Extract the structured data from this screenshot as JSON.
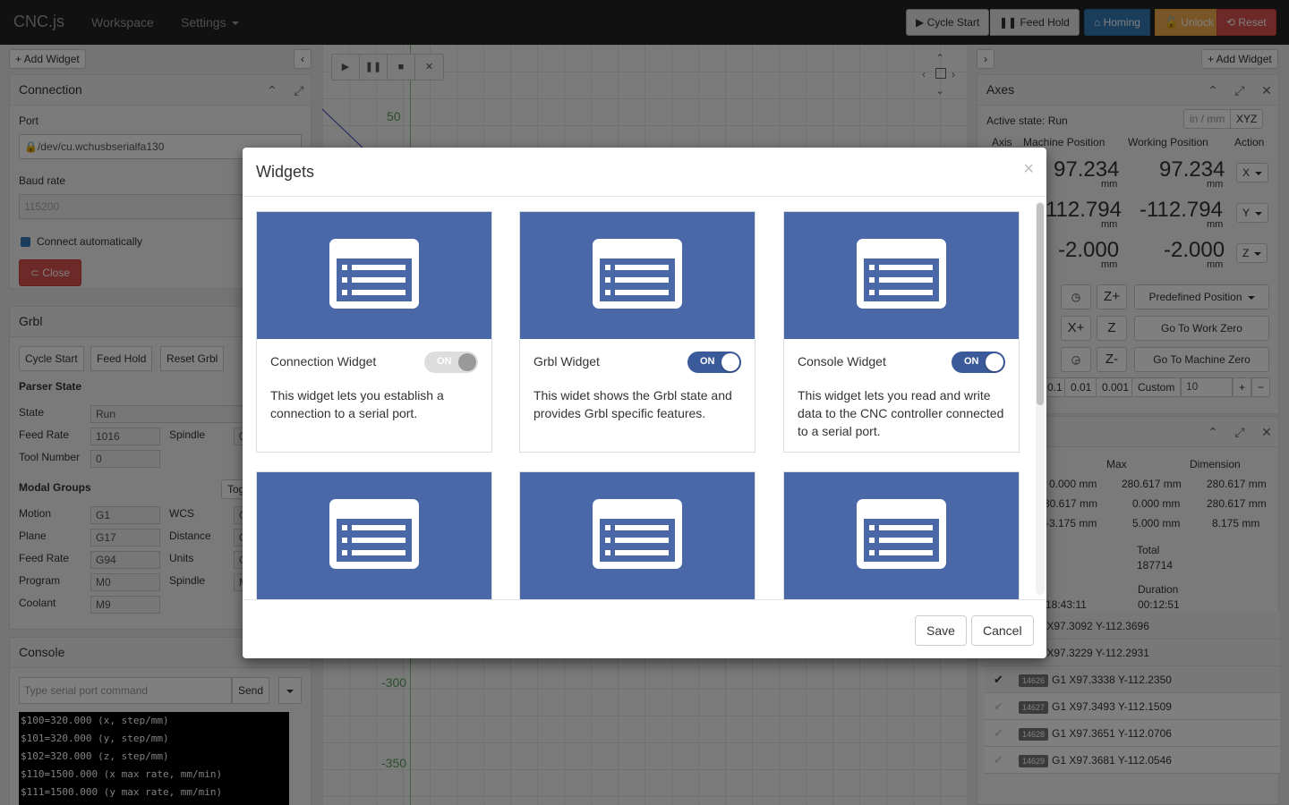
{
  "navbar": {
    "brand": "CNC.js",
    "workspace": "Workspace",
    "settings": "Settings",
    "cycle_start": "▶ Cycle Start",
    "feed_hold": "❚❚ Feed Hold",
    "homing": "⌂ Homing",
    "unlock": "🔓 Unlock",
    "reset": "⟲ Reset"
  },
  "left": {
    "add_widget": "+ Add Widget",
    "connection": {
      "title": "Connection",
      "port_label": "Port",
      "port_value": "/dev/cu.wchusbserialfa130",
      "baud_label": "Baud rate",
      "baud_value": "115200",
      "auto_connect": "Connect automatically",
      "close_button": "Close"
    },
    "grbl": {
      "title": "Grbl",
      "cycle_start": "Cycle Start",
      "feed_hold": "Feed Hold",
      "reset_grbl": "Reset Grbl",
      "parser_state": "Parser State",
      "state_label": "State",
      "state_value": "Run",
      "feed_rate_label": "Feed Rate",
      "feed_rate_value": "1016",
      "spindle_label": "Spindle",
      "spindle_value": "0",
      "tool_number_label": "Tool Number",
      "tool_number_value": "0",
      "modal_groups": "Modal Groups",
      "toggle": "Tog",
      "motion_label": "Motion",
      "motion_value": "G1",
      "wcs_label": "WCS",
      "wcs_value": "G",
      "plane_label": "Plane",
      "plane_value": "G17",
      "distance_label": "Distance",
      "distance_value": "G",
      "feedrate_mode_label": "Feed Rate",
      "feedrate_mode_value": "G94",
      "units_label": "Units",
      "units_value": "G",
      "program_label": "Program",
      "program_value": "M0",
      "spindle2_label": "Spindle",
      "spindle2_value": "M",
      "coolant_label": "Coolant",
      "coolant_value": "M9"
    },
    "console": {
      "title": "Console",
      "placeholder": "Type serial port command",
      "send": "Send",
      "lines": [
        "$100=320.000 (x, step/mm)",
        "$101=320.000 (y, step/mm)",
        "$102=320.000 (z, step/mm)",
        "$110=1500.000 (x max rate, mm/min)",
        "$111=1500.000 (y max rate, mm/min)"
      ]
    }
  },
  "center": {
    "labels": [
      "50",
      "-300",
      "-350"
    ]
  },
  "right": {
    "add_widget": "+ Add Widget",
    "axes": {
      "title": "Axes",
      "active_state": "Active state: Run",
      "units_toggle": "in / mm",
      "axes_select": "XYZ",
      "col_axis": "Axis",
      "col_machine": "Machine Position",
      "col_working": "Working Position",
      "col_action": "Action",
      "rows": [
        {
          "axis": "X",
          "machine": "97.234",
          "working": "97.234"
        },
        {
          "axis": "Y",
          "machine": "-112.794",
          "working": "-112.794"
        },
        {
          "axis": "Z",
          "machine": "-2.000",
          "working": "-2.000"
        }
      ],
      "unit": "mm",
      "zplus": "Z+",
      "xplus": "X+",
      "zlabel": "Z",
      "zminus": "Z-",
      "predefined": "Predefined Position",
      "go_work_zero": "Go To Work Zero",
      "go_machine_zero": "Go To Machine Zero",
      "steps": [
        "0.1",
        "0.01",
        "0.001",
        "Custom"
      ],
      "custom_value": "10"
    },
    "gcode": {
      "col_max": "Max",
      "col_dimension": "Dimension",
      "rows": [
        {
          "min": "0.000 mm",
          "max": "280.617 mm",
          "dim": "280.617 mm"
        },
        {
          "min": "80.617 mm",
          "max": "0.000 mm",
          "dim": "280.617 mm"
        },
        {
          "min": "-3.175 mm",
          "max": "5.000 mm",
          "dim": "8.175 mm"
        }
      ],
      "total_label": "Total",
      "total_value": "187714",
      "duration_label": "Duration",
      "duration_value": "00:12:51",
      "start_time": "18:43:11",
      "lines": [
        {
          "num": "",
          "code": "G1 X97.3092 Y-112.3696"
        },
        {
          "num": "",
          "code": "G1 X97.3229 Y-112.2931"
        },
        {
          "num": "14626",
          "code": "G1 X97.3338 Y-112.2350"
        },
        {
          "num": "14627",
          "code": "G1 X97.3493 Y-112.1509"
        },
        {
          "num": "14628",
          "code": "G1 X97.3651 Y-112.0706"
        },
        {
          "num": "14629",
          "code": "G1 X97.3681 Y-112.0546"
        }
      ]
    }
  },
  "modal": {
    "title": "Widgets",
    "close": "×",
    "save": "Save",
    "cancel": "Cancel",
    "cards": [
      {
        "title": "Connection Widget",
        "toggle": "ON",
        "state": "off",
        "desc": "This widget lets you establish a connection to a serial port."
      },
      {
        "title": "Grbl Widget",
        "toggle": "ON",
        "state": "on",
        "desc": "This widet shows the Grbl state and provides Grbl specific features."
      },
      {
        "title": "Console Widget",
        "toggle": "ON",
        "state": "on",
        "desc": "This widget lets you read and write data to the CNC controller connected to a serial port."
      }
    ]
  },
  "colors": {
    "card_image": "#4a68a8",
    "toggle_on": "#3b5a9a",
    "navbar": "#222222"
  }
}
